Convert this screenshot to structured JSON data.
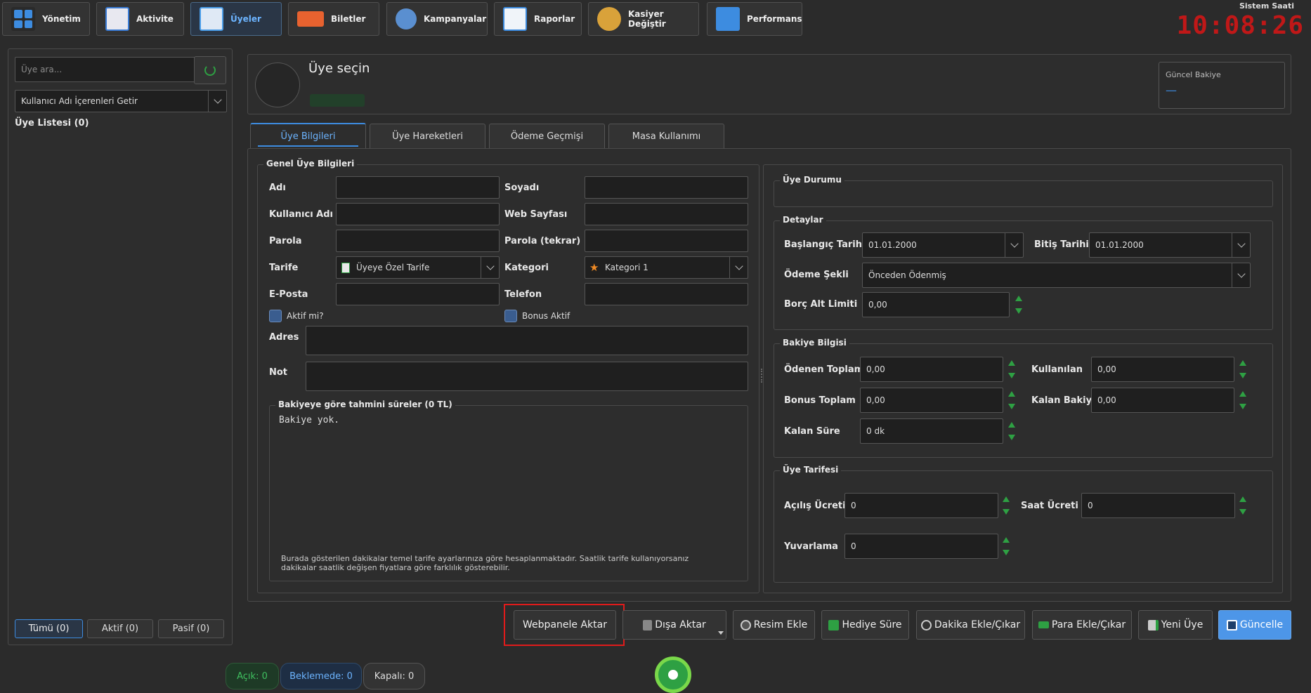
{
  "nav": [
    {
      "label": "Yönetim",
      "icon": "grid-icon",
      "color": "#3d8ce0"
    },
    {
      "label": "Aktivite",
      "icon": "activity-icon",
      "color": "#3a7bd5"
    },
    {
      "label": "Üyeler",
      "icon": "members-icon",
      "color": "#4a9de8"
    },
    {
      "label": "Biletler",
      "icon": "ticket-icon",
      "color": "#e8622f"
    },
    {
      "label": "Kampanyalar",
      "icon": "tools-icon",
      "color": "#5a8fd0"
    },
    {
      "label": "Raporlar",
      "icon": "report-icon",
      "color": "#3d8ce0"
    },
    {
      "label": "Kasiyer Değiştir",
      "icon": "cashier-icon",
      "color": "#d9a23a"
    },
    {
      "label": "Performans",
      "icon": "performance-icon",
      "color": "#3d8ce0"
    }
  ],
  "clock": {
    "label": "Sistem Saati",
    "time": "10:08:26",
    "color": "#c01818"
  },
  "sidebar": {
    "search_placeholder": "Üye ara...",
    "filter": "Kullanıcı Adı İçerenleri Getir",
    "list_title": "Üye Listesi (0)",
    "filters": [
      "Tümü (0)",
      "Aktif (0)",
      "Pasif (0)"
    ]
  },
  "header": {
    "title": "Üye seçin",
    "balance_label": "Güncel Bakiye",
    "balance_value": "—"
  },
  "tabs": [
    "Üye Bilgileri",
    "Üye Hareketleri",
    "Ödeme Geçmişi",
    "Masa Kullanımı"
  ],
  "general": {
    "title": "Genel Üye Bilgileri",
    "name": "Adı",
    "surname": "Soyadı",
    "username": "Kullanıcı Adı",
    "website": "Web Sayfası",
    "password": "Parola",
    "password2": "Parola (tekrar)",
    "tariff": "Tarife",
    "tariff_value": "Üyeye Özel Tarife",
    "category": "Kategori",
    "category_value": "Kategori 1",
    "email": "E-Posta",
    "phone": "Telefon",
    "active_chk": "Aktif mi?",
    "bonus_chk": "Bonus Aktif",
    "address": "Adres",
    "note": "Not",
    "estimate_title": "Bakiyeye göre tahmini süreler (0 TL)",
    "estimate_text": "Bakiye yok.",
    "footnote_1": "Burada gösterilen dakikalar temel tarife ayarlarınıza göre hesaplanmaktadır. Saatlik tarife kullanıyorsanız",
    "footnote_2": "dakikalar saatlik değişen fiyatlara göre farklılık gösterebilir."
  },
  "status": {
    "title": "Üye Durumu"
  },
  "details": {
    "title": "Detaylar",
    "start_label": "Başlangıç Tarihi",
    "start_value": "01.01.2000",
    "end_label": "Bitiş Tarihi",
    "end_value": "01.01.2000",
    "payment_label": "Ödeme Şekli",
    "payment_value": "Önceden Ödenmiş",
    "debt_label": "Borç Alt Limiti",
    "debt_value": "0,00"
  },
  "balance": {
    "title": "Bakiye Bilgisi",
    "paid_label": "Ödenen Toplam",
    "paid_value": "0,00",
    "used_label": "Kullanılan",
    "used_value": "0,00",
    "bonus_label": "Bonus Toplam",
    "bonus_value": "0,00",
    "remaining_label": "Kalan Bakiye",
    "remaining_value": "0,00",
    "time_label": "Kalan Süre",
    "time_value": "0 dk"
  },
  "member_tariff": {
    "title": "Üye Tarifesi",
    "opening_label": "Açılış Ücreti",
    "opening_value": "0",
    "hourly_label": "Saat Ücreti",
    "hourly_value": "0",
    "rounding_label": "Yuvarlama",
    "rounding_value": "0"
  },
  "actions": [
    "Webpanele Aktar",
    "Dışa Aktar",
    "Resim Ekle",
    "Hediye Süre",
    "Dakika Ekle/Çıkar",
    "Para Ekle/Çıkar",
    "Yeni Üye",
    "Güncelle"
  ],
  "footer": {
    "open": "Açık: 0",
    "waiting": "Beklemede: 0",
    "closed": "Kapalı: 0"
  },
  "colors": {
    "accent": "#3d8ce0",
    "primary_button": "#4d96e8",
    "highlight": "#e01b1b",
    "spinner": "#2ea043"
  }
}
